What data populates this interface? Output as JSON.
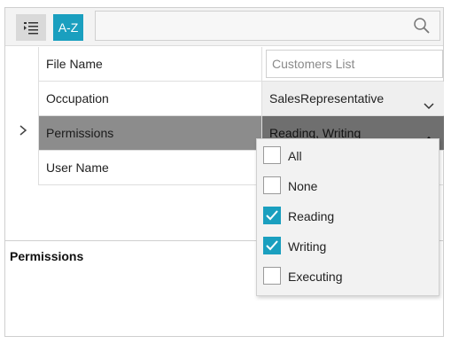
{
  "toolbar": {
    "categorize_icon": "categorized-list-icon",
    "sort_label": "A-Z",
    "search_placeholder": "",
    "search_icon": "search-icon"
  },
  "properties": [
    {
      "name": "File Name",
      "value": "Customers List"
    },
    {
      "name": "Occupation",
      "value": "SalesRepresentative"
    },
    {
      "name": "Permissions",
      "value": "Reading, Writing"
    },
    {
      "name": "User Name",
      "value": ""
    }
  ],
  "description": {
    "title": "Permissions"
  },
  "dropdown": {
    "options": [
      {
        "label": "All",
        "checked": false
      },
      {
        "label": "None",
        "checked": false
      },
      {
        "label": "Reading",
        "checked": true
      },
      {
        "label": "Writing",
        "checked": true
      },
      {
        "label": "Executing",
        "checked": false
      }
    ]
  },
  "colors": {
    "accent": "#1a9fbf",
    "selected_row": "#8c8c8c",
    "selected_value": "#6f6f6f"
  }
}
